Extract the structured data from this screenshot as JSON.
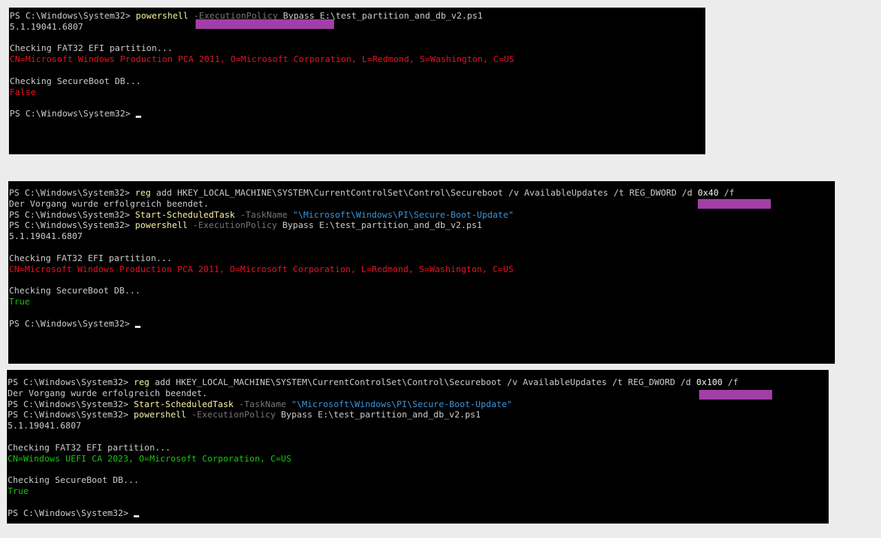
{
  "prompt": "PS C:\\Windows\\System32> ",
  "cmd_powershell": "powershell",
  "arg_exec_policy": " -ExecutionPolicy",
  "arg_bypass_path": " Bypass E:\\test_partition_and_db_v2.ps1",
  "version": "5.1.19041.6807",
  "check_efi": "Checking FAT32 EFI partition...",
  "old_cert": "CN=Microsoft Windows Production PCA 2011, O=Microsoft Corporation, L=Redmond, S=Washington, C=US",
  "new_cert": "CN=Windows UEFI CA 2023, O=Microsoft Corporation, C=US",
  "check_db": "Checking SecureBoot DB...",
  "false_text": "False",
  "true_text": "True",
  "cmd_reg": "reg",
  "reg_args": " add HKEY_LOCAL_MACHINE\\SYSTEM\\CurrentControlSet\\Control\\Secureboot /v AvailableUpdates /t REG_DWORD /d ",
  "reg_value_1": "0x40",
  "reg_value_2": "0x100",
  "reg_force": " /f",
  "success_msg": "Der Vorgang wurde erfolgreich beendet.",
  "cmd_task": "Start-ScheduledTask",
  "arg_taskname": " -TaskName",
  "task_path": " \"\\Microsoft\\Windows\\PI\\Secure-Boot-Update\"",
  "colors": {
    "background": "#000000",
    "default_text": "#cccccc",
    "command": "#f9f1a5",
    "parameter": "#767676",
    "error": "#e81123",
    "success": "#16c60c",
    "string": "#3a96dd",
    "redaction": "#a23ea8"
  }
}
